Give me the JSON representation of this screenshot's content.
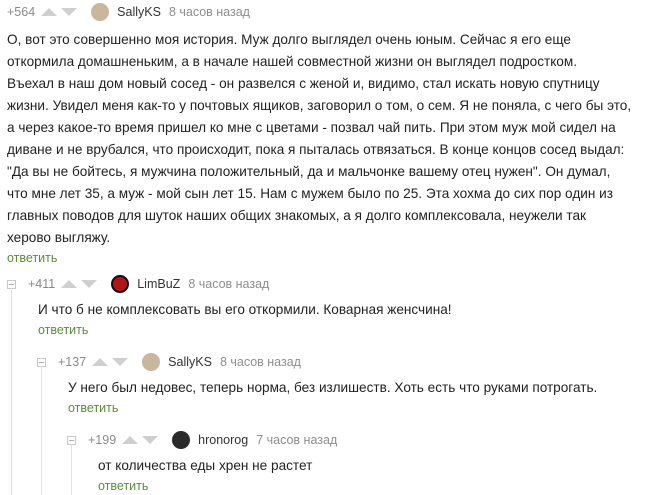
{
  "reply_label": "ответить",
  "comments": [
    {
      "rating": "+564",
      "user": "SallyKS",
      "time": "8 часов назад",
      "avatar_color": "#c9b79c",
      "lines": [
        "О, вот это совершенно моя история. Муж долго выглядел очень юным. Сейчас я его еще",
        "откормила домашненьким, а в начале нашей совместной жизни он выглядел подростком.",
        "Въехал в наш дом новый сосед - он развелся с женой и, видимо, стал искать новую спутницу",
        "жизни. Увидел меня как-то у почтовых ящиков, заговорил о том, о сем. Я не поняла, с чего бы это,",
        "а через какое-то время пришел ко мне с цветами - позвал чай пить. При этом муж мой сидел на",
        "диване и не врубался, что происходит, пока я пыталась отвязаться. В конце концов сосед выдал:",
        "\"Да вы не бойтесь, я мужчина положительный, да и мальчонке вашему отец нужен\". Он думал,",
        "что мне лет 35, а муж - мой сын лет 15. Нам с мужем было по 25. Эта хохма до сих пор один из",
        "главных поводов для шуток наших общих знакомых, а я долго комплексовала, неужели так",
        "херово выгляжу."
      ]
    },
    {
      "rating": "+411",
      "user": "LimBuZ",
      "time": "8 часов назад",
      "avatar_color": "#b3141a",
      "lines": [
        "И что б не комплексовать вы его откормили. Коварная женсчина!"
      ]
    },
    {
      "rating": "+137",
      "user": "SallyKS",
      "time": "8 часов назад",
      "avatar_color": "#c9b79c",
      "lines": [
        "У него был недовес, теперь норма, без излишеств. Хоть есть что руками потрогать."
      ]
    },
    {
      "rating": "+199",
      "user": "hronorog",
      "time": "7 часов назад",
      "avatar_color": "#2a2a2a",
      "lines": [
        "от количества еды хрен не растет"
      ]
    }
  ]
}
